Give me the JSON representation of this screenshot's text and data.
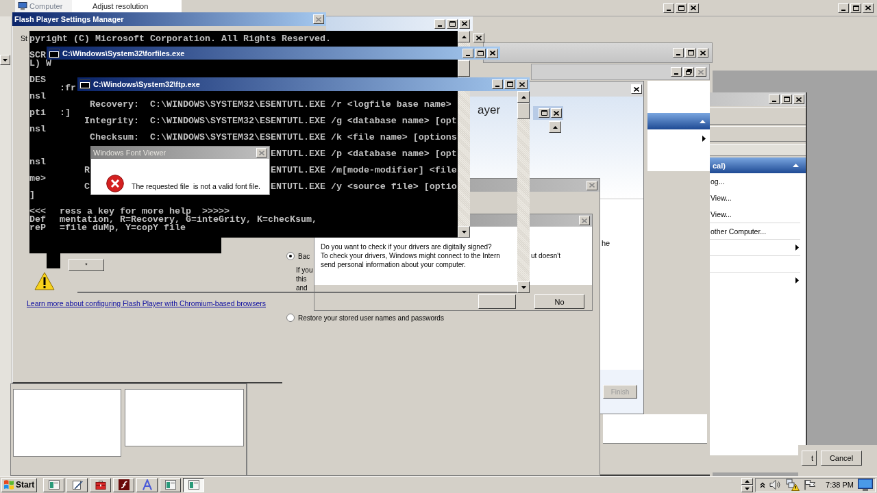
{
  "top_strip": {
    "window_title": "Computer",
    "link": "Adjust resolution"
  },
  "flash_settings": {
    "title": "Flash Player Settings Manager",
    "active": true,
    "tab": "St",
    "small_button": "*",
    "link": "Learn more about configuring Flash Player with Chromium-based browsers"
  },
  "esentutl_console": {
    "lines": [
      {
        "kind": "header",
        "text": "pyright (C) Microsoft Corporation. All Rights Reserved."
      },
      {
        "kind": "blank"
      },
      {
        "kind": "text",
        "fragment": "SCR"
      },
      {
        "kind": "text",
        "fragment": "L) W"
      },
      {
        "kind": "blank"
      },
      {
        "kind": "text",
        "fragment": "DES"
      },
      {
        "kind": "text",
        "tail": ":fr"
      },
      {
        "kind": "text",
        "fragment": "nsl"
      },
      {
        "kind": "usage",
        "label": "Recovery:",
        "command": "C:\\WINDOWS\\SYSTEM32\\ESENTUTL.EXE /r <logfile base name>"
      },
      {
        "kind": "text",
        "fragment": "pti",
        "tail": ":]"
      },
      {
        "kind": "usage",
        "label": "Integrity:",
        "command": "C:\\WINDOWS\\SYSTEM32\\ESENTUTL.EXE /g <database name> [opt"
      },
      {
        "kind": "text",
        "fragment": "nsl"
      },
      {
        "kind": "usage",
        "label": "Checksum:",
        "command": "C:\\WINDOWS\\SYSTEM32\\ESENTUTL.EXE /k <file name> [options"
      },
      {
        "kind": "blank"
      },
      {
        "kind": "usage_partial",
        "command": "ENTUTL.EXE /p <database name> [opt"
      },
      {
        "kind": "text",
        "fragment": "nsl"
      },
      {
        "kind": "usage_partial",
        "label": "R",
        "command": "ENTUTL.EXE /m[mode-modifier] <file"
      },
      {
        "kind": "text",
        "fragment": "me>"
      },
      {
        "kind": "usage_partial",
        "label": "C",
        "command": "ENTUTL.EXE /y <source file> [optio"
      },
      {
        "kind": "text",
        "fragment": "]"
      },
      {
        "kind": "blank"
      },
      {
        "kind": "text",
        "fragment": "<<<",
        "tail": "ress a key for more help  >>>>>"
      },
      {
        "kind": "text",
        "fragment": "Def",
        "tail": "mentation, R=Recovery, G=inteGrity, K=checKsum,"
      },
      {
        "kind": "text",
        "fragment": "reP",
        "tail": "=file duMp, Y=copY file"
      }
    ]
  },
  "forfiles": {
    "title": "C:\\Windows\\System32\\forfiles.exe",
    "active": true
  },
  "ftp": {
    "title": "C:\\Windows\\System32\\ftp.exe",
    "active": true
  },
  "font_viewer": {
    "title": "Windows Font Viewer",
    "active": false,
    "message": "The requested file  is not a valid font file."
  },
  "setup_window": {
    "heading": "ayer",
    "fragment": "he",
    "finish": {
      "label": "Finish",
      "disabled": true
    }
  },
  "management_panel": {
    "header": "cal)",
    "items": [
      {
        "label": "og...",
        "submenu": false
      },
      {
        "label": "View...",
        "submenu": false
      },
      {
        "label": "View...",
        "submenu": false
      },
      {
        "label": "other Computer...",
        "submenu": false
      },
      {
        "submenu": true
      },
      {
        "submenu": false
      },
      {
        "submenu": true
      }
    ]
  },
  "backup_dialog": {
    "active": false,
    "options": [
      {
        "label": "Bac",
        "selected": true,
        "details": [
          "If you",
          "this",
          "and"
        ]
      },
      {
        "label": "Restore your stored user names and passwords",
        "selected": false
      }
    ]
  },
  "driver_dialog": {
    "active": false,
    "lines": [
      [
        "Do you want to check if your drivers are digitally signed?"
      ],
      [
        "To check your drivers, Windows might connect to the Intern",
        "ut doesn't"
      ],
      [
        "send personal information about your computer."
      ]
    ],
    "buttons": [
      {
        "kind": "blank"
      },
      {
        "kind": "text",
        "label": "No"
      }
    ]
  },
  "bottom_dialog": {
    "buttons": [
      {
        "label": "t"
      },
      {
        "label": "Cancel"
      }
    ]
  },
  "taskbar": {
    "start": "Start",
    "items": [
      {
        "kind": "window",
        "selected": false
      },
      {
        "kind": "edit",
        "selected": false
      },
      {
        "kind": "toolbox",
        "selected": false
      },
      {
        "kind": "flash",
        "selected": false
      },
      {
        "kind": "font",
        "selected": false
      },
      {
        "kind": "window",
        "selected": false
      },
      {
        "kind": "window",
        "selected": true
      }
    ],
    "clock": "7:38 PM"
  }
}
